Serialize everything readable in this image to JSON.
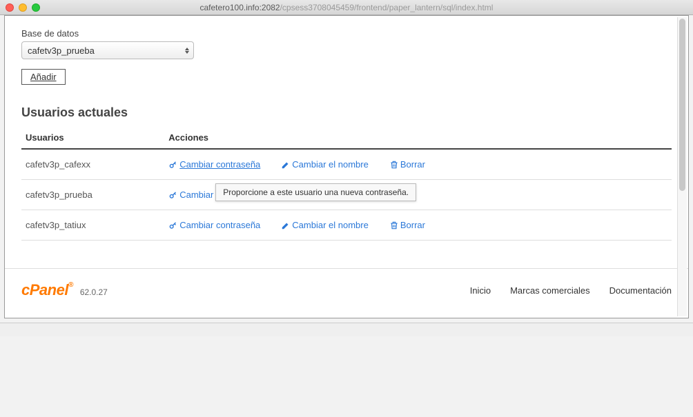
{
  "titlebar": {
    "host": "cafetero100.info:2082",
    "path": "/cpsess3708045459/frontend/paper_lantern/sql/index.html"
  },
  "db": {
    "label": "Base de datos",
    "selected": "cafetv3p_prueba"
  },
  "add_button": "Añadir",
  "section_title": "Usuarios actuales",
  "table": {
    "headers": {
      "user": "Usuarios",
      "actions": "Acciones"
    },
    "action_labels": {
      "change_password": "Cambiar contraseña",
      "change_name": "Cambiar el nombre",
      "delete": "Borrar",
      "change_partial": "Cambiar"
    },
    "rows": [
      {
        "user": "cafetv3p_cafexx"
      },
      {
        "user": "cafetv3p_prueba"
      },
      {
        "user": "cafetv3p_tatiux"
      }
    ]
  },
  "tooltip": "Proporcione a este usuario una nueva contraseña.",
  "footer": {
    "logo": "cPanel",
    "version": "62.0.27",
    "links": {
      "home": "Inicio",
      "trademarks": "Marcas comerciales",
      "docs": "Documentación"
    }
  }
}
